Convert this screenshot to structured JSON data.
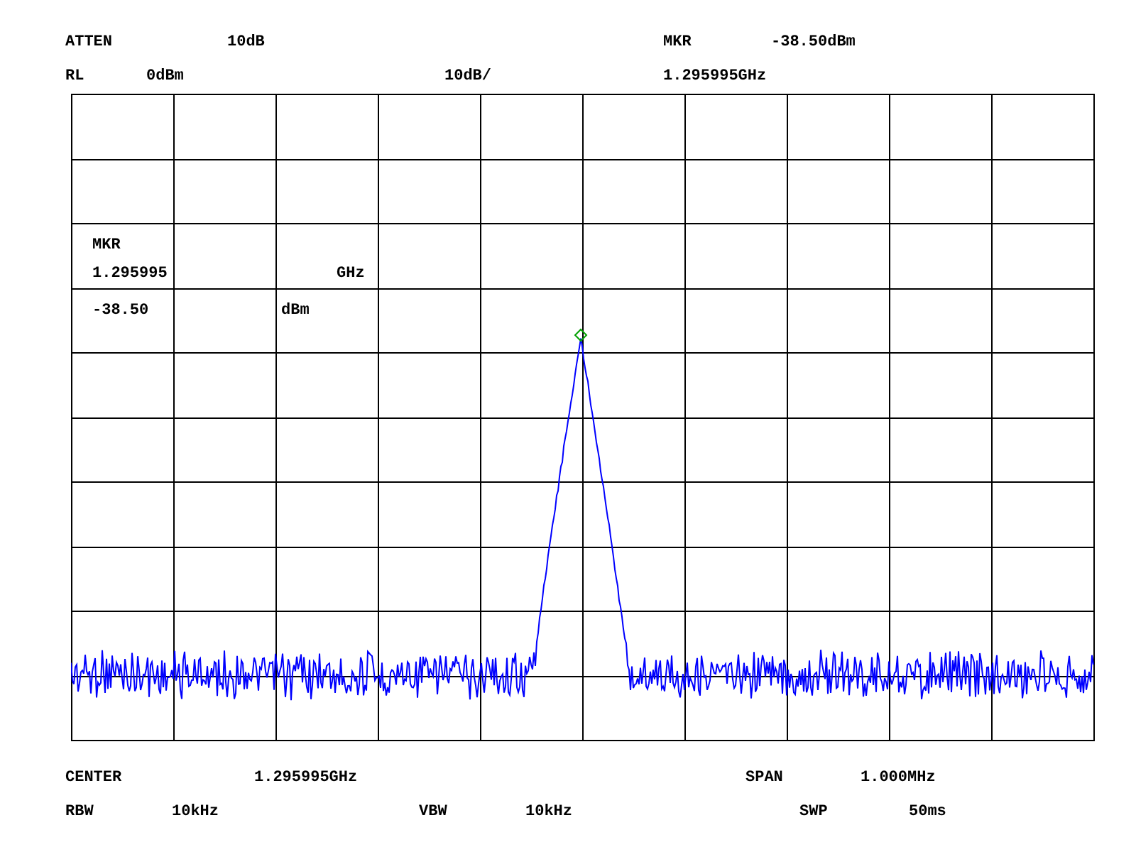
{
  "header": {
    "attenuation_label": "ATTEN",
    "attenuation": "10dB",
    "marker_label": "MKR",
    "marker_level": "-38.50dBm",
    "reference_label": "RL",
    "reference_level": "0dBm",
    "scale": "10dB/",
    "marker_frequency": "1.295995GHz"
  },
  "marker_readout": {
    "label": "MKR",
    "frequency": "1.295995",
    "frequency_unit": "GHz",
    "level": "-38.50",
    "level_unit": "dBm"
  },
  "footer": {
    "center_label": "CENTER",
    "center_frequency": "1.295995GHz",
    "span_label": "SPAN",
    "span": "1.000MHz",
    "rbw_label": "RBW",
    "rbw": "10kHz",
    "vbw_label": "VBW",
    "vbw": "10kHz",
    "sweep_label": "SWP",
    "sweep_time": "50ms"
  }
}
